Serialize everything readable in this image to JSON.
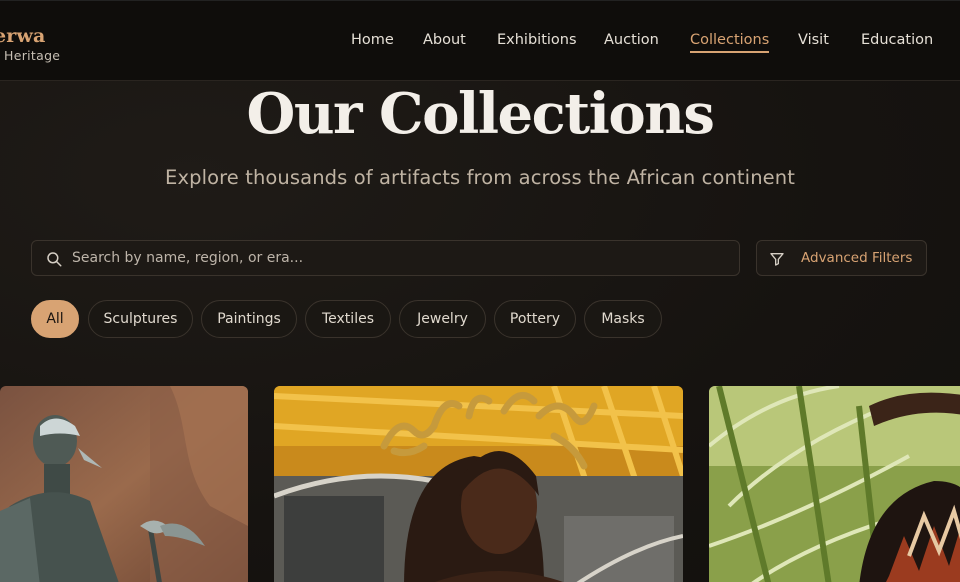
{
  "brand": {
    "title": "erwa",
    "subtitle": "Heritage"
  },
  "nav": [
    {
      "label": "Home"
    },
    {
      "label": "About"
    },
    {
      "label": "Exhibitions"
    },
    {
      "label": "Auction"
    },
    {
      "label": "Collections",
      "active": true
    },
    {
      "label": "Visit"
    },
    {
      "label": "Education"
    }
  ],
  "hero": {
    "title": "Our Collections",
    "subtitle": "Explore thousands of artifacts from across the African continent"
  },
  "search": {
    "placeholder": "Search by name, region, or era...",
    "value": ""
  },
  "filters_button": {
    "label": "Advanced Filters"
  },
  "categories": [
    {
      "label": "All",
      "active": true
    },
    {
      "label": "Sculptures"
    },
    {
      "label": "Paintings"
    },
    {
      "label": "Textiles"
    },
    {
      "label": "Jewelry"
    },
    {
      "label": "Pottery"
    },
    {
      "label": "Masks"
    }
  ],
  "colors": {
    "accent": "#d8a373",
    "background": "#161310",
    "header": "#0f0d0b"
  }
}
